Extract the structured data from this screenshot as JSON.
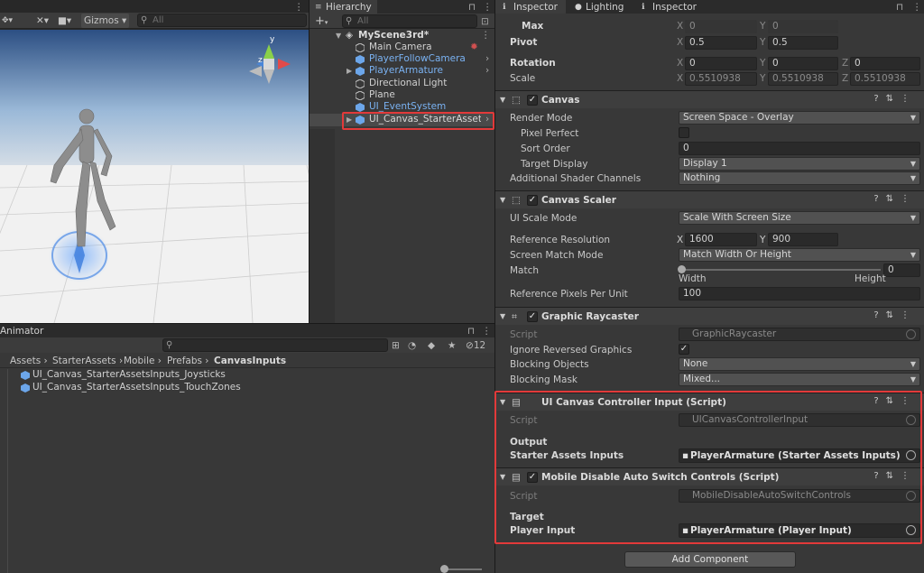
{
  "scene": {
    "gizmos_label": "Gizmos",
    "search_placeholder": "All",
    "axis_y": "y",
    "axis_z": "z"
  },
  "hierarchy": {
    "tab_label": "Hierarchy",
    "add_label": "+",
    "search_placeholder": "All",
    "scene_name": "MyScene3rd*",
    "items": [
      {
        "label": "Main Camera"
      },
      {
        "label": "PlayerFollowCamera"
      },
      {
        "label": "PlayerArmature"
      },
      {
        "label": "Directional Light"
      },
      {
        "label": "Plane"
      },
      {
        "label": "UI_EventSystem"
      },
      {
        "label": "UI_Canvas_StarterAssetsInputs_Joysticks"
      }
    ]
  },
  "project": {
    "tab_label": "Animator",
    "badge_count": "12",
    "breadcrumb": [
      "Assets",
      "StarterAssets",
      "Mobile",
      "Prefabs",
      "CanvasInputs"
    ],
    "files": [
      {
        "label": "UI_Canvas_StarterAssetsInputs_Joysticks"
      },
      {
        "label": "UI_Canvas_StarterAssetsInputs_TouchZones"
      }
    ]
  },
  "inspector": {
    "tabs": [
      {
        "label": "Inspector"
      },
      {
        "label": "Lighting"
      },
      {
        "label": "Inspector"
      }
    ],
    "transform": {
      "max_label": "Max",
      "max_x": "0",
      "max_y": "0",
      "pivot_label": "Pivot",
      "pivot_x": "0.5",
      "pivot_y": "0.5",
      "rotation_label": "Rotation",
      "rot_x": "0",
      "rot_y": "0",
      "rot_z": "0",
      "scale_label": "Scale",
      "scale_x": "0.5510938",
      "scale_y": "0.5510938",
      "scale_z": "0.5510938",
      "x": "X",
      "y": "Y",
      "z": "Z"
    },
    "canvas": {
      "title": "Canvas",
      "render_mode_label": "Render Mode",
      "render_mode": "Screen Space - Overlay",
      "pixel_perfect_label": "Pixel Perfect",
      "sort_order_label": "Sort Order",
      "sort_order": "0",
      "target_display_label": "Target Display",
      "target_display": "Display 1",
      "shader_channels_label": "Additional Shader Channels",
      "shader_channels": "Nothing"
    },
    "canvas_scaler": {
      "title": "Canvas Scaler",
      "ui_scale_mode_label": "UI Scale Mode",
      "ui_scale_mode": "Scale With Screen Size",
      "ref_res_label": "Reference Resolution",
      "ref_res_x": "1600",
      "ref_res_y": "900",
      "match_mode_label": "Screen Match Mode",
      "match_mode": "Match Width Or Height",
      "match_label": "Match",
      "match_value": "0",
      "width_label": "Width",
      "height_label": "Height",
      "ppu_label": "Reference Pixels Per Unit",
      "ppu": "100"
    },
    "raycaster": {
      "title": "Graphic Raycaster",
      "script_label": "Script",
      "script": "GraphicRaycaster",
      "ignore_label": "Ignore Reversed Graphics",
      "blocking_objects_label": "Blocking Objects",
      "blocking_objects": "None",
      "blocking_mask_label": "Blocking Mask",
      "blocking_mask": "Mixed..."
    },
    "controller_input": {
      "title": "UI Canvas Controller Input (Script)",
      "script_label": "Script",
      "script": "UICanvasControllerInput",
      "output_label": "Output",
      "starter_label": "Starter Assets Inputs",
      "starter_value": "PlayerArmature (Starter Assets Inputs)"
    },
    "mobile_disable": {
      "title": "Mobile Disable Auto Switch Controls (Script)",
      "script_label": "Script",
      "script": "MobileDisableAutoSwitchControls",
      "target_label": "Target",
      "player_input_label": "Player Input",
      "player_input_value": "PlayerArmature (Player Input)"
    },
    "add_component": "Add Component"
  },
  "colors": {
    "highlight_red": "#e23a3a",
    "link_blue": "#7ab2f2",
    "panel": "#383838"
  }
}
